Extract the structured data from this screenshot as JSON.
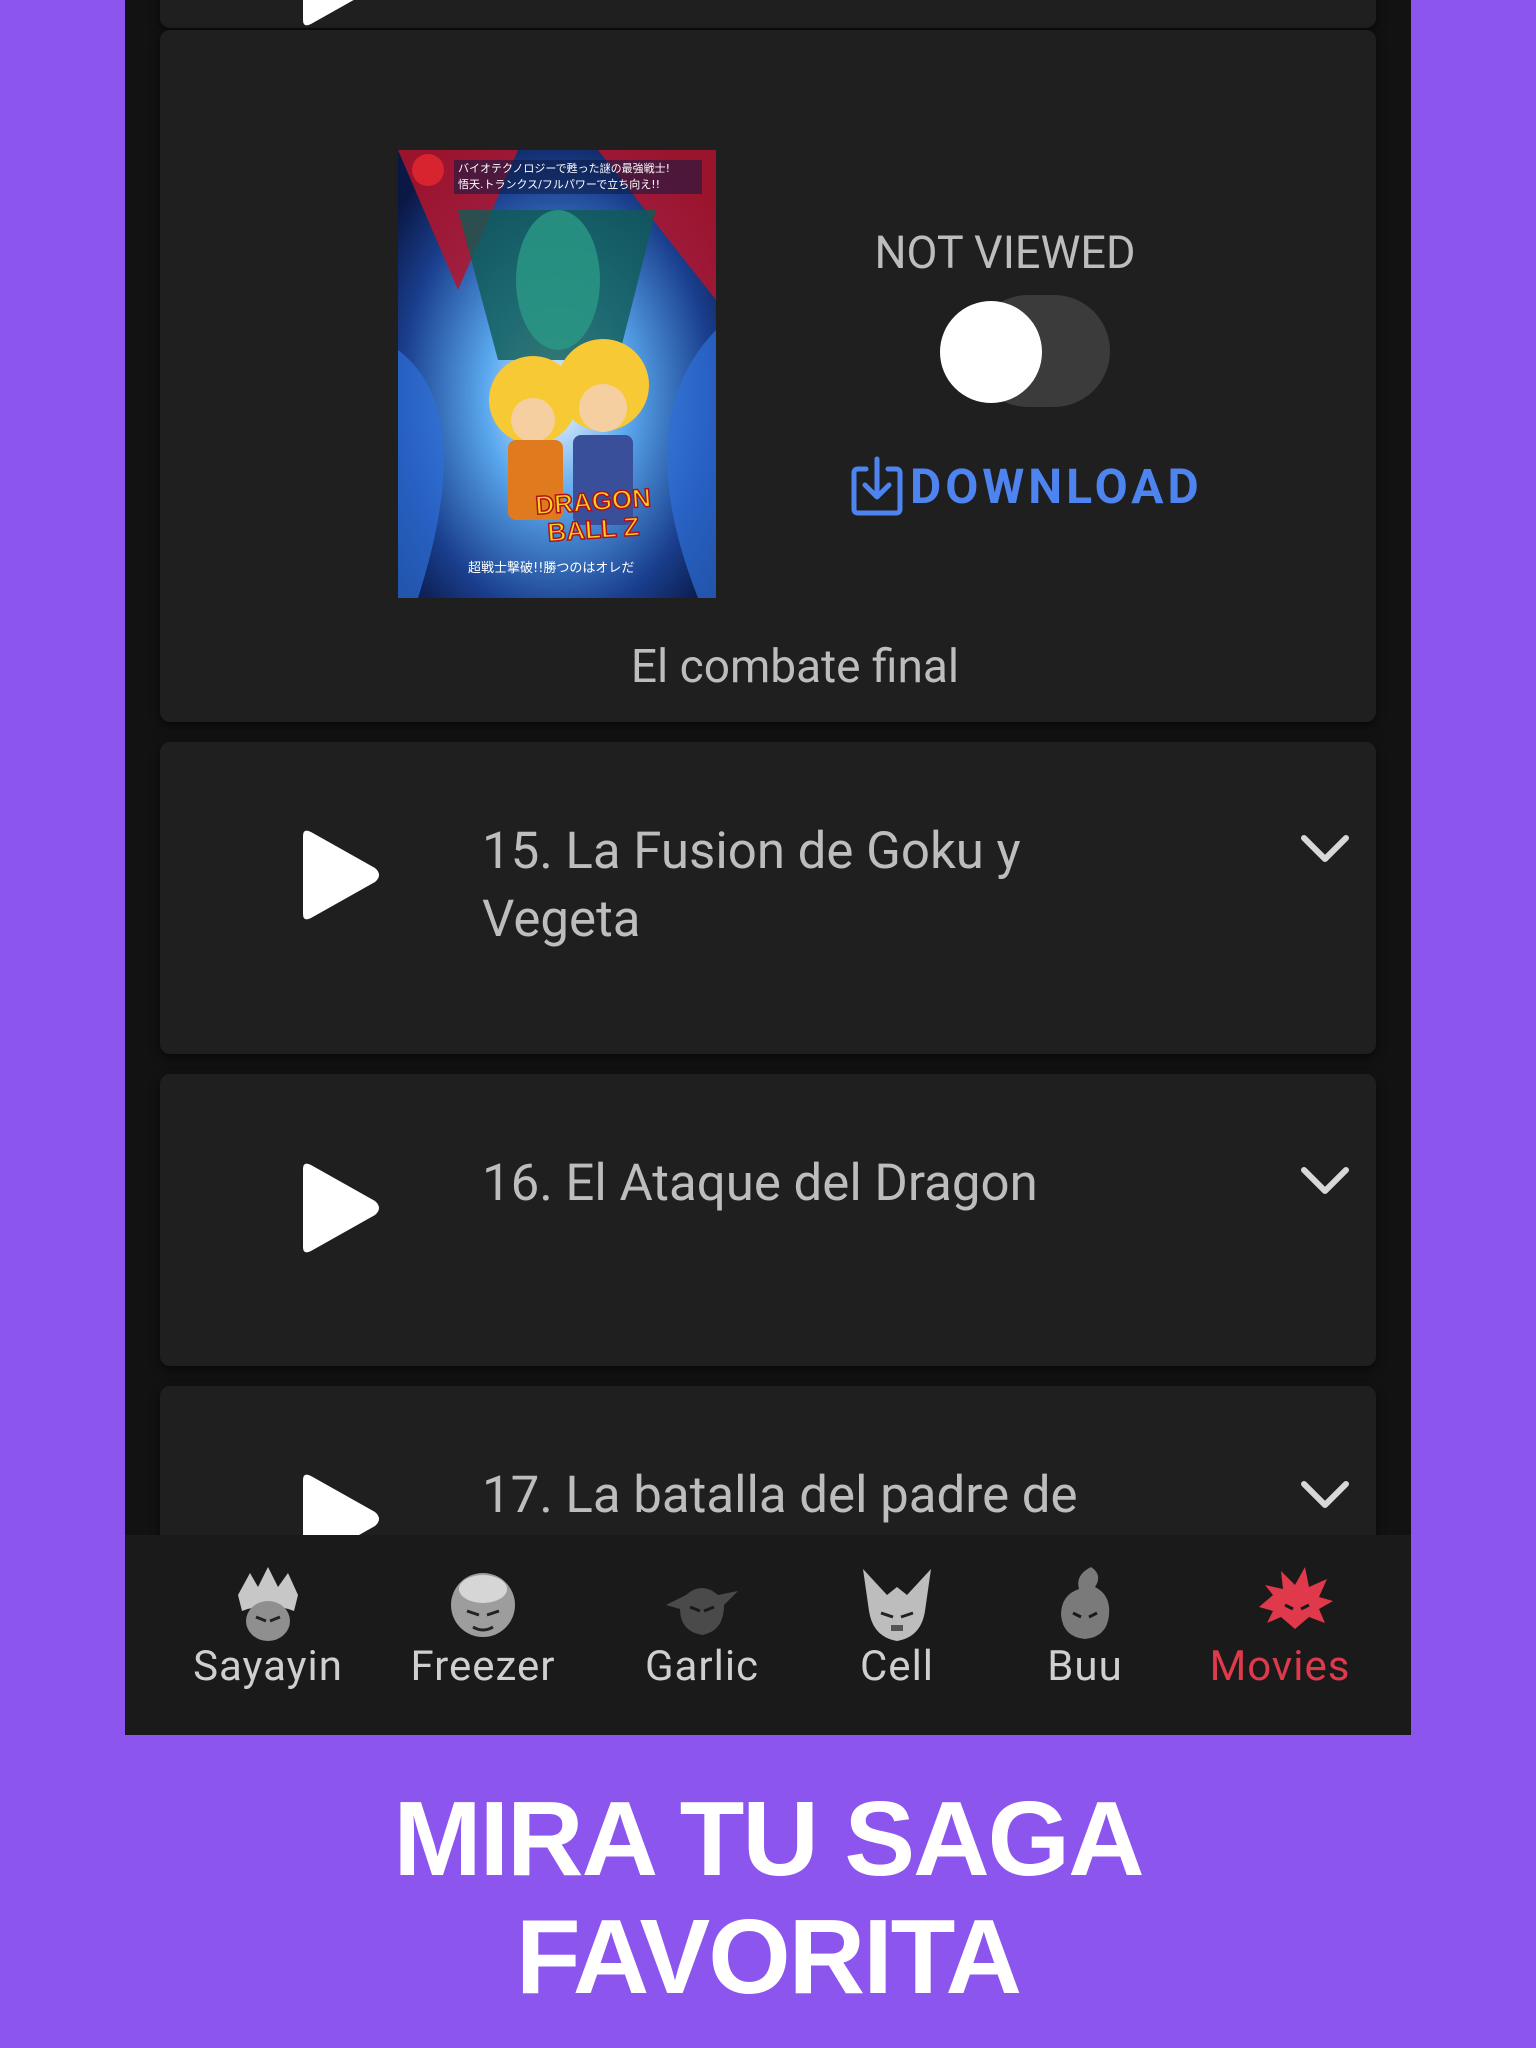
{
  "movie_card": {
    "status_label": "NOT VIEWED",
    "viewed": false,
    "download_label": "DOWNLOAD",
    "description": "El combate final",
    "poster_texts": {
      "line1": "バイオテクノロジーで甦った謎の最強戦士!",
      "line2": "悟天.トランクス/フルパワーで立ち向え!!",
      "logo_line1": "DRAGON",
      "logo_line2": "BALL Z",
      "subtitle": "超戦士撃破!!勝つのはオレだ"
    }
  },
  "episodes": [
    {
      "title": "15. La Fusion de Goku y Vegeta"
    },
    {
      "title": "16. El Ataque del Dragon"
    },
    {
      "title": "17. La batalla del padre de"
    }
  ],
  "nav": {
    "items": [
      {
        "label": "Sayayin",
        "icon": "sayayin-icon",
        "active": false
      },
      {
        "label": "Freezer",
        "icon": "freezer-icon",
        "active": false
      },
      {
        "label": "Garlic",
        "icon": "garlic-icon",
        "active": false
      },
      {
        "label": "Cell",
        "icon": "cell-icon",
        "active": false
      },
      {
        "label": "Buu",
        "icon": "buu-icon",
        "active": false
      },
      {
        "label": "Movies",
        "icon": "movies-icon",
        "active": true
      }
    ],
    "active_color": "#e0394b",
    "inactive_color": "#cfcfcf"
  },
  "promo": {
    "line1": "MIRA TU SAGA",
    "line2": "FAVORITA"
  },
  "colors": {
    "background": "#8c55ee",
    "card": "#1f1f20",
    "accent": "#4d84ef"
  }
}
